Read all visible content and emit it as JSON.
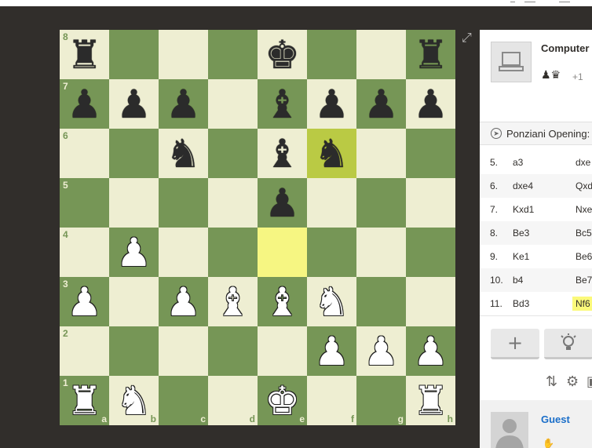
{
  "board": {
    "rank_labels": [
      "8",
      "7",
      "6",
      "5",
      "4",
      "3",
      "2",
      "1"
    ],
    "file_labels": [
      "a",
      "b",
      "c",
      "d",
      "e",
      "f",
      "g",
      "h"
    ],
    "highlight_squares": [
      "e4",
      "f6"
    ],
    "colors": {
      "light": "#eeeed2",
      "dark": "#769656",
      "highlight_light": "#f6f682",
      "highlight_dark": "#baca44"
    },
    "pieces": [
      {
        "sq": "a8",
        "c": "b",
        "g": "♜",
        "n": "black-rook"
      },
      {
        "sq": "e8",
        "c": "b",
        "g": "♚",
        "n": "black-king"
      },
      {
        "sq": "h8",
        "c": "b",
        "g": "♜",
        "n": "black-rook"
      },
      {
        "sq": "a7",
        "c": "b",
        "g": "♟",
        "n": "black-pawn"
      },
      {
        "sq": "b7",
        "c": "b",
        "g": "♟",
        "n": "black-pawn"
      },
      {
        "sq": "c7",
        "c": "b",
        "g": "♟",
        "n": "black-pawn"
      },
      {
        "sq": "e7",
        "c": "b",
        "g": "♝",
        "n": "black-bishop"
      },
      {
        "sq": "f7",
        "c": "b",
        "g": "♟",
        "n": "black-pawn"
      },
      {
        "sq": "g7",
        "c": "b",
        "g": "♟",
        "n": "black-pawn"
      },
      {
        "sq": "h7",
        "c": "b",
        "g": "♟",
        "n": "black-pawn"
      },
      {
        "sq": "c6",
        "c": "b",
        "g": "♞",
        "n": "black-knight"
      },
      {
        "sq": "e6",
        "c": "b",
        "g": "♝",
        "n": "black-bishop"
      },
      {
        "sq": "f6",
        "c": "b",
        "g": "♞",
        "n": "black-knight"
      },
      {
        "sq": "e5",
        "c": "b",
        "g": "♟",
        "n": "black-pawn"
      },
      {
        "sq": "b4",
        "c": "w",
        "g": "♟",
        "n": "white-pawn"
      },
      {
        "sq": "a3",
        "c": "w",
        "g": "♟",
        "n": "white-pawn"
      },
      {
        "sq": "c3",
        "c": "w",
        "g": "♟",
        "n": "white-pawn"
      },
      {
        "sq": "d3",
        "c": "w",
        "g": "♝",
        "n": "white-bishop"
      },
      {
        "sq": "e3",
        "c": "w",
        "g": "♝",
        "n": "white-bishop"
      },
      {
        "sq": "f3",
        "c": "w",
        "g": "♞",
        "n": "white-knight"
      },
      {
        "sq": "f2",
        "c": "w",
        "g": "♟",
        "n": "white-pawn"
      },
      {
        "sq": "g2",
        "c": "w",
        "g": "♟",
        "n": "white-pawn"
      },
      {
        "sq": "h2",
        "c": "w",
        "g": "♟",
        "n": "white-pawn"
      },
      {
        "sq": "a1",
        "c": "w",
        "g": "♜",
        "n": "white-rook"
      },
      {
        "sq": "b1",
        "c": "w",
        "g": "♞",
        "n": "white-knight"
      },
      {
        "sq": "e1",
        "c": "w",
        "g": "♚",
        "n": "white-king"
      },
      {
        "sq": "h1",
        "c": "w",
        "g": "♜",
        "n": "white-rook"
      }
    ]
  },
  "opponent": {
    "name": "Computer",
    "captured_icons": "♟♛",
    "advantage": "+1"
  },
  "opening": {
    "icon": "compass-icon",
    "label": "Ponziani Opening: ..."
  },
  "moves": [
    {
      "num": "5.",
      "white": "a3",
      "black": "dxe"
    },
    {
      "num": "6.",
      "white": "dxe4",
      "black": "Qxd"
    },
    {
      "num": "7.",
      "white": "Kxd1",
      "black": "Nxe"
    },
    {
      "num": "8.",
      "white": "Be3",
      "black": "Bc5"
    },
    {
      "num": "9.",
      "white": "Ke1",
      "black": "Be6"
    },
    {
      "num": "10.",
      "white": "b4",
      "black": "Be7"
    },
    {
      "num": "11.",
      "white": "Bd3",
      "black": "Nf6"
    }
  ],
  "controls": {
    "add_icon": "+",
    "hint_icon": "bulb-icon",
    "flip_icon": "⇅",
    "settings_icon": "⚙"
  },
  "player": {
    "name": "Guest"
  }
}
